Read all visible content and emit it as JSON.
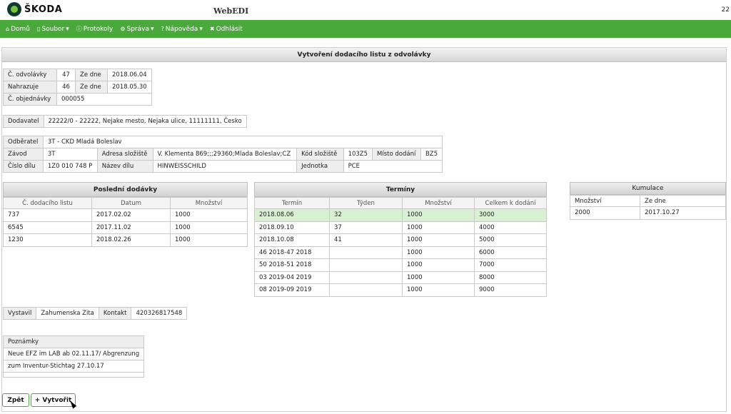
{
  "header": {
    "brand": "ŠKODA",
    "app_title": "WebEDI",
    "right_text": "22"
  },
  "nav": [
    {
      "icon": "⌂",
      "label": "Domů",
      "caret": ""
    },
    {
      "icon": "▯",
      "label": "Soubor",
      "caret": "▾"
    },
    {
      "icon": "ⓘ",
      "label": "Protokoly",
      "caret": ""
    },
    {
      "icon": "⚙",
      "label": "Správa",
      "caret": "▾"
    },
    {
      "icon": "?",
      "label": "Nápověda",
      "caret": "▾"
    },
    {
      "icon": "✖",
      "label": "Odhlásit",
      "caret": ""
    }
  ],
  "page_title": "Vytvoření dodacího listu z odvolávky",
  "order": {
    "odvolavky_label": "Č. odvolávky",
    "odvolavky_value": "47",
    "ze_dne_label": "Ze dne",
    "ze_dne_1": "2018.06.04",
    "nahrazuje_label": "Nahrazuje",
    "nahrazuje_value": "46",
    "ze_dne_2": "2018.05.30",
    "objednavky_label": "Č. objednávky",
    "objednavky_value": "000055"
  },
  "supplier": {
    "label": "Dodavatel",
    "value": "22222/0 - 22222, Nejake mesto, Nejaka ulice, 11111111, Česko"
  },
  "recipient": {
    "odberatel_label": "Odběratel",
    "odberatel_value": "3T - CKD Mladá Boleslav",
    "zavod_label": "Závod",
    "zavod_value": "3T",
    "adresa_label": "Adresa složiště",
    "adresa_value": "V. Klementa 869;;;29360;Mlada Boleslav;CZ",
    "kod_label": "Kód složiště",
    "kod_value": "103Z5",
    "misto_label": "Místo dodání",
    "misto_value": "BZ5",
    "cislo_dilu_label": "Číslo dílu",
    "cislo_dilu_value": "1Z0 010 748 P",
    "nazev_label": "Název dílu",
    "nazev_value": "HINWEISSCHILD",
    "jednotka_label": "Jednotka",
    "jednotka_value": "PCE"
  },
  "last_deliveries": {
    "title": "Poslední dodávky",
    "columns": [
      "Č. dodacího listu",
      "Datum",
      "Množství"
    ],
    "rows": [
      [
        "737",
        "2017.02.02",
        "1000"
      ],
      [
        "6545",
        "2017.11.02",
        "1000"
      ],
      [
        "1230",
        "2018.02.26",
        "1000"
      ]
    ]
  },
  "terms": {
    "title": "Termíny",
    "columns": [
      "Termín",
      "Týden",
      "Množství",
      "Celkem k dodání"
    ],
    "rows": [
      [
        "2018.08.06",
        "32",
        "1000",
        "3000"
      ],
      [
        "2018.09.10",
        "37",
        "1000",
        "4000"
      ],
      [
        "2018.10.08",
        "41",
        "1000",
        "5000"
      ],
      [
        "46 2018-47 2018",
        "",
        "1000",
        "6000"
      ],
      [
        "50 2018-51 2018",
        "",
        "1000",
        "7000"
      ],
      [
        "03 2019-04 2019",
        "",
        "1000",
        "8000"
      ],
      [
        "08 2019-09 2019",
        "",
        "1000",
        "9000"
      ]
    ]
  },
  "cumulation": {
    "title": "Kumulace",
    "columns": [
      "Množství",
      "Ze dne"
    ],
    "rows": [
      [
        "2000",
        "2017.10.27"
      ]
    ]
  },
  "issuer": {
    "vystavil_label": "Vystavil",
    "vystavil_value": "Zahumenska Zita",
    "kontakt_label": "Kontakt",
    "kontakt_value": "420326817548"
  },
  "notes": {
    "title": "Poznámky",
    "lines": [
      "Neue EFZ im LAB ab 02.11.17/ Abgrenzung",
      "zum Inventur-Stichtag 27.10.17"
    ]
  },
  "buttons": {
    "back": "Zpět",
    "create": "+ Vytvořit"
  }
}
